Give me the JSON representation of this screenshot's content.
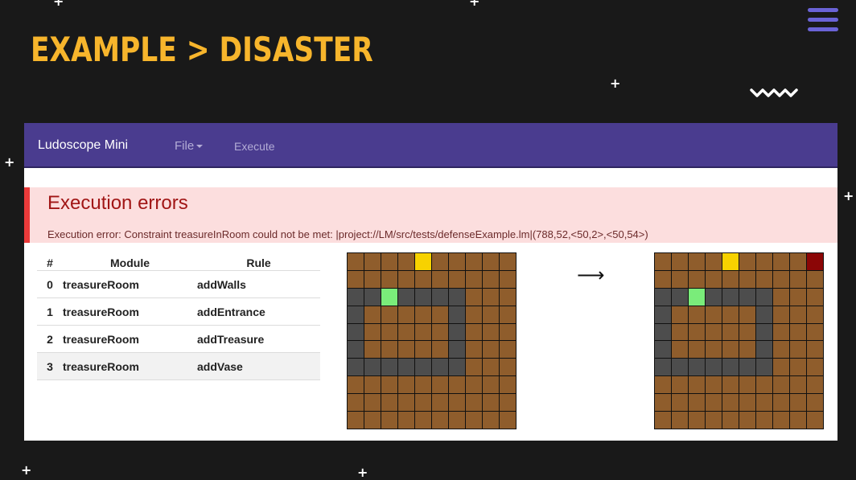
{
  "slide": {
    "title": "EXAMPLE > DISASTER",
    "accent_color": "#f7b52c",
    "menu_icon": "hamburger-menu-icon",
    "decorations": [
      "plus-icon",
      "zigzag-icon"
    ]
  },
  "app": {
    "brand": "Ludoscope Mini",
    "nav": {
      "file_label": "File",
      "execute_label": "Execute"
    }
  },
  "errors": {
    "title": "Execution errors",
    "message": "Execution error: Constraint treasureInRoom could not be met: |project://LM/src/tests/defenseExample.lm|(788,52,<50,2>,<50,54>)"
  },
  "table": {
    "headers": [
      "#",
      "Module",
      "Rule"
    ],
    "rows": [
      {
        "index": "0",
        "module": "treasureRoom",
        "rule": "addWalls"
      },
      {
        "index": "1",
        "module": "treasureRoom",
        "rule": "addEntrance"
      },
      {
        "index": "2",
        "module": "treasureRoom",
        "rule": "addTreasure"
      },
      {
        "index": "3",
        "module": "treasureRoom",
        "rule": "addVase"
      }
    ]
  },
  "transition": {
    "arrow": "⟶"
  },
  "maps": {
    "legend_colors": {
      "F": "#8f5d2c",
      "W": "#4d4d4d",
      "Y": "#f7d200",
      "G": "#7aec7a",
      "R": "#8b0606"
    },
    "before": [
      "FFFFYFFFFF",
      "FFFFFFFFFF",
      "WWGWWWWFFF",
      "WFFFFFWFFF",
      "WFFFFFWFFF",
      "WFFFFFWFFF",
      "WWWWWWWFFF",
      "FFFFFFFFFF",
      "FFFFFFFFFF",
      "FFFFFFFFFF"
    ],
    "after": [
      "FFFFYFFFFR",
      "FFFFFFFFFF",
      "WWGWWWWFFF",
      "WFFFFFWFFF",
      "WFFFFFWFFF",
      "WFFFFFWFFF",
      "WWWWWWWFFF",
      "FFFFFFFFFF",
      "FFFFFFFFFF",
      "FFFFFFFFFF"
    ]
  }
}
